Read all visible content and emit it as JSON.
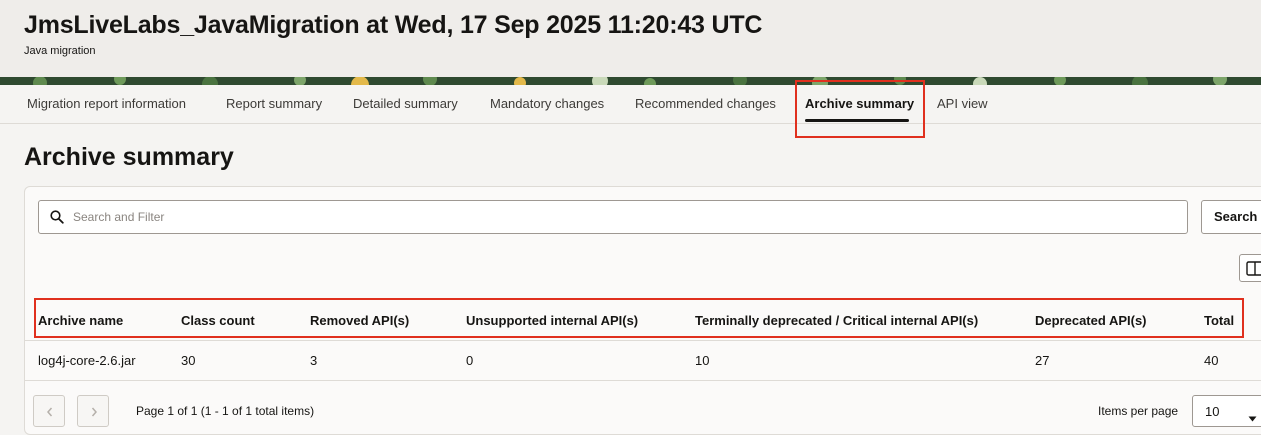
{
  "header": {
    "title": "JmsLiveLabs_JavaMigration at Wed, 17 Sep 2025 11:20:43 UTC",
    "subtitle": "Java migration"
  },
  "tabs": [
    {
      "label": "Migration report information",
      "active": false
    },
    {
      "label": "Report summary",
      "active": false
    },
    {
      "label": "Detailed summary",
      "active": false
    },
    {
      "label": "Mandatory changes",
      "active": false
    },
    {
      "label": "Recommended changes",
      "active": false
    },
    {
      "label": "Archive summary",
      "active": true
    },
    {
      "label": "API view",
      "active": false
    }
  ],
  "page_title": "Archive summary",
  "search": {
    "placeholder": "Search and Filter",
    "value": "",
    "button_label": "Search"
  },
  "table": {
    "columns": [
      "Archive name",
      "Class count",
      "Removed API(s)",
      "Unsupported internal API(s)",
      "Terminally deprecated / Critical internal API(s)",
      "Deprecated API(s)",
      "Total"
    ],
    "rows": [
      [
        "log4j-core-2.6.jar",
        "30",
        "3",
        "0",
        "10",
        "27",
        "40"
      ]
    ]
  },
  "pagination": {
    "info": "Page 1 of 1 (1 - 1 of 1 total items)",
    "items_per_page_label": "Items per page",
    "items_per_page_value": "10"
  },
  "colors": {
    "highlight": "#e0301e",
    "banner_green": "#2f4a30",
    "text": "#161513"
  },
  "icons": [
    "search-icon",
    "columns-icon",
    "chevron-left-icon",
    "chevron-right-icon",
    "chevron-down-icon"
  ]
}
